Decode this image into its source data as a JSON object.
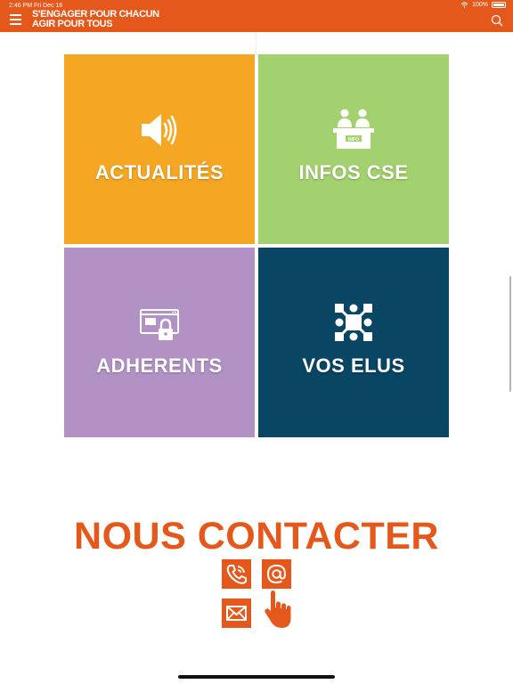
{
  "status_bar": {
    "time_date": "2:46 PM   Fri Dec 16",
    "battery": "100%"
  },
  "header": {
    "title_line1": "S'ENGAGER POUR CHACUN",
    "title_line2": "AGIR POUR TOUS"
  },
  "tiles": [
    {
      "label": "ACTUALITÉS",
      "color": "#f5a623",
      "icon": "speaker-icon"
    },
    {
      "label": "INFOS CSE",
      "color": "#a3d16f",
      "icon": "reception-desk-icon",
      "icon_text": "INFO"
    },
    {
      "label": "ADHERENTS",
      "color": "#b292c4",
      "icon": "secure-window-lock-icon"
    },
    {
      "label": "VOS ELUS",
      "color": "#084663",
      "icon": "puzzle-network-icon"
    }
  ],
  "contact": {
    "title": "NOUS CONTACTER",
    "icons": [
      "phone-icon",
      "at-sign-icon",
      "envelope-icon",
      "pointing-hand-icon"
    ]
  },
  "colors": {
    "brand_orange": "#e4581b"
  }
}
